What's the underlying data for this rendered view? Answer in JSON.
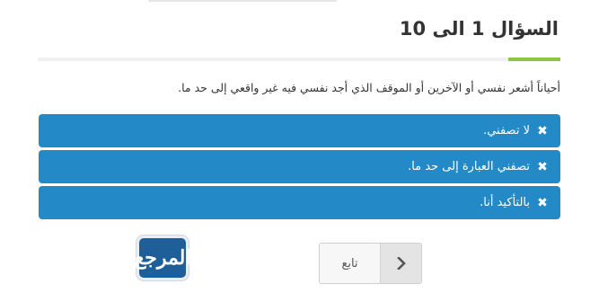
{
  "quiz": {
    "title": "السؤال 1 الى 10",
    "question": "أحياناً أشعر نفسي أو الآخرين أو الموقف الذي أجد نفسي فيه غير واقعي إلى حد ما.",
    "options": [
      {
        "label": "لا تصفني.",
        "icon": "close-icon"
      },
      {
        "label": "تصفني العبارة إلى حد ما.",
        "icon": "close-icon"
      },
      {
        "label": "بالتأكيد أنا.",
        "icon": "close-icon"
      }
    ],
    "next_label": "تابع",
    "next_icon": "chevron-right-icon"
  },
  "logo": {
    "text": "المرجع"
  },
  "colors": {
    "option_bg": "#2389c7",
    "accent": "#8cc63f",
    "logo_bg": "#1f5f99"
  }
}
